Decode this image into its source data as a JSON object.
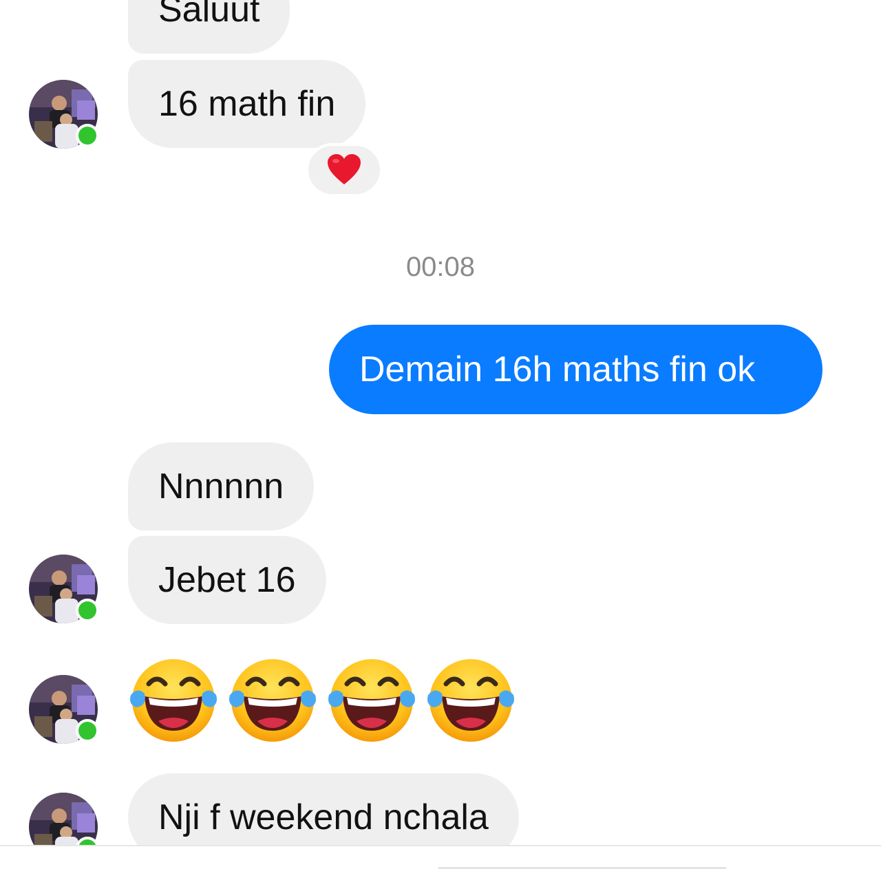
{
  "conversation": {
    "messages": [
      {
        "direction": "incoming",
        "text": "Saluut"
      },
      {
        "direction": "incoming",
        "text": "16 math fin",
        "reaction": "heart-emoji"
      },
      {
        "direction": "outgoing",
        "text": "Demain 16h maths fin ok"
      },
      {
        "direction": "incoming",
        "text": "Nnnnnn"
      },
      {
        "direction": "incoming",
        "text": "Jebet 16"
      },
      {
        "direction": "incoming",
        "emoji": [
          "face-with-tears-of-joy-emoji",
          "face-with-tears-of-joy-emoji",
          "face-with-tears-of-joy-emoji",
          "face-with-tears-of-joy-emoji"
        ]
      },
      {
        "direction": "incoming",
        "text": "Nji f weekend nchala"
      }
    ],
    "timestamp": "00:08"
  },
  "contact": {
    "status": "online",
    "presence_color": "#31c42f"
  },
  "colors": {
    "outgoing_bubble": "#0a7cff",
    "incoming_bubble": "#efefef",
    "timestamp_text": "#8a8a8a"
  }
}
